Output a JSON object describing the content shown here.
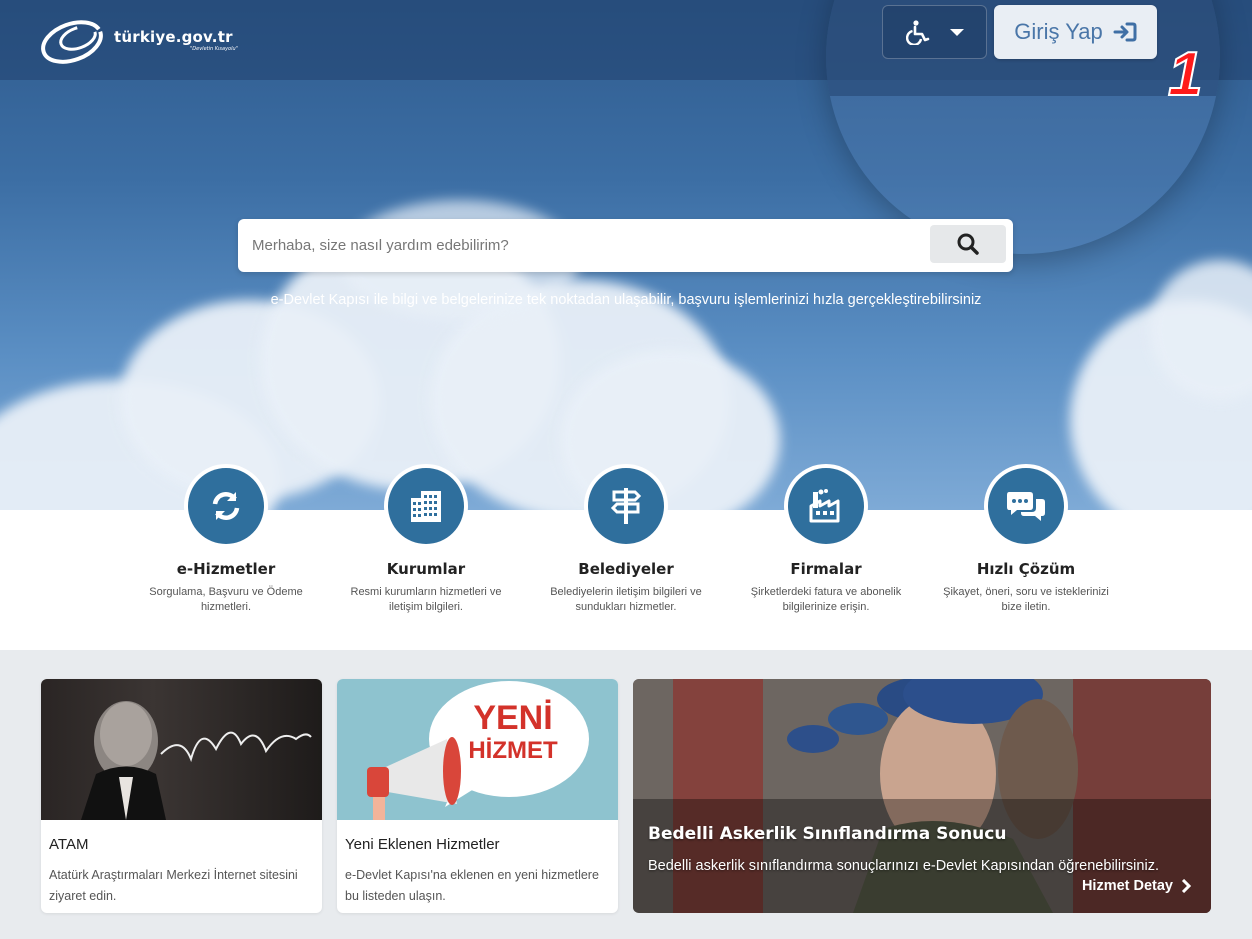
{
  "header": {
    "logo_text": "türkiye.gov.tr",
    "logo_subtitle": "\"Devletin Kısayolu\"",
    "accessibility_icon": "wheelchair-icon",
    "login_label": "Giriş Yap",
    "login_icon": "sign-in-icon"
  },
  "annotation": {
    "number": "1"
  },
  "search": {
    "placeholder": "Merhaba, size nasıl yardım edebilirim?",
    "icon": "search-icon",
    "tagline": "e-Devlet Kapısı ile bilgi ve belgelerinize tek noktadan ulaşabilir, başvuru işlemlerinizi hızla gerçekleştirebilirsiniz"
  },
  "categories": [
    {
      "title": "e-Hizmetler",
      "desc": "Sorgulama, Başvuru ve Ödeme hizmetleri.",
      "icon": "refresh-icon"
    },
    {
      "title": "Kurumlar",
      "desc": "Resmi kurumların hizmetleri ve iletişim bilgileri.",
      "icon": "building-icon"
    },
    {
      "title": "Belediyeler",
      "desc": "Belediyelerin iletişim bilgileri ve sundukları hizmetler.",
      "icon": "signpost-icon"
    },
    {
      "title": "Firmalar",
      "desc": "Şirketlerdeki fatura ve abonelik bilgilerinize erişin.",
      "icon": "factory-icon"
    },
    {
      "title": "Hızlı Çözüm",
      "desc": "Şikayet, öneri, soru ve isteklerinizi bize iletin.",
      "icon": "chat-icon"
    }
  ],
  "cards": [
    {
      "title": "ATAM",
      "desc": "Atatürk Araştırmaları Merkezi İnternet sitesini ziyaret edin.",
      "image_caption": "K. Atatürk"
    },
    {
      "title": "Yeni Eklenen Hizmetler",
      "desc": "e-Devlet Kapısı'na eklenen en yeni hizmetlere bu listeden ulaşın.",
      "badge_line1": "YENİ",
      "badge_line2": "HİZMET"
    }
  ],
  "featured": {
    "title": "Bedelli Askerlik Sınıflandırma Sonucu",
    "desc": "Bedelli askerlik sınıflandırma sonuçlarınızı e-Devlet Kapısından öğrenebilirsiniz.",
    "link_label": "Hizmet Detay"
  },
  "colors": {
    "primary": "#2f6f9d",
    "annotation": "#ff1a1a",
    "login_text": "#4a76a8"
  }
}
